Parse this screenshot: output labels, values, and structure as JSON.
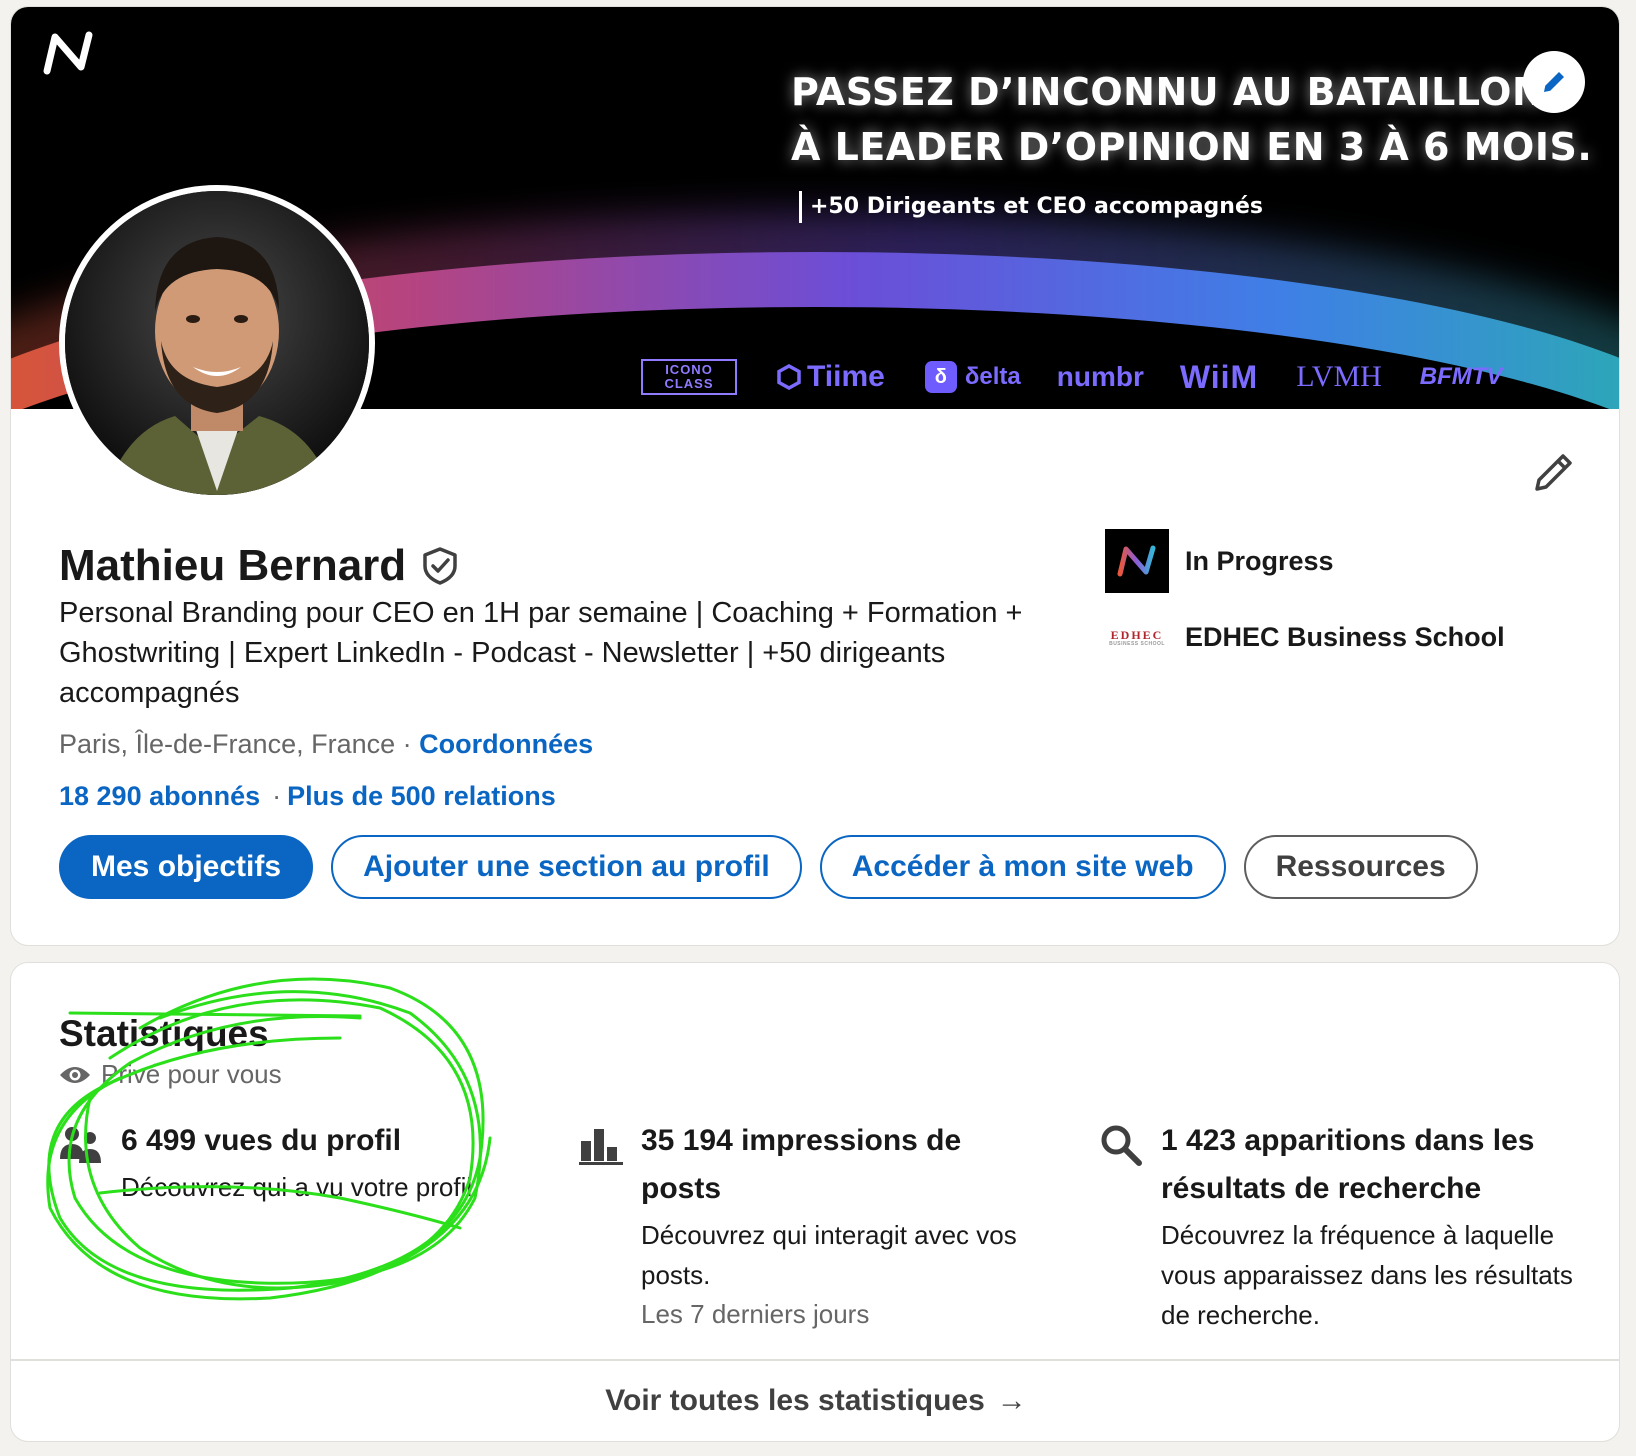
{
  "banner": {
    "headline_line1": "PASSEZ D’INCONNU AU BATAILLON",
    "headline_line2": "À LEADER D’OPINION EN 3 À 6 MOIS.",
    "subhead": "+50 Dirigeants et CEO accompagnés",
    "logos": {
      "icono_line1": "ICONO",
      "icono_line2": "CLASS",
      "tiime": "Tiime",
      "delta_mark": "δ",
      "delta": "δelta",
      "numbr": "numbr",
      "wiim": "WiiM",
      "lvmh": "LVMH",
      "bfmtv": "BFMTV"
    }
  },
  "profile": {
    "name": "Mathieu Bernard",
    "tagline": "Personal Branding pour CEO en 1H par semaine | Coaching + Formation + Ghostwriting | Expert LinkedIn - Podcast - Newsletter | +50 dirigeants accompagnés",
    "location": "Paris, Île-de-France, France",
    "location_separator": " · ",
    "contact_link": "Coordonnées",
    "followers": "18 290 abonnés",
    "connections": "Plus de 500 relations",
    "affiliations": [
      {
        "name": "In Progress",
        "logo_icon": "in-progress-logo"
      },
      {
        "name": "EDHEC Business School",
        "logo_text": "EDHEC",
        "logo_subtext": "BUSINESS SCHOOL"
      }
    ]
  },
  "actions": {
    "primary": "Mes objectifs",
    "add_section": "Ajouter une section au profil",
    "website": "Accéder à mon site web",
    "resources": "Ressources"
  },
  "stats": {
    "title": "Statistiques",
    "privacy": "Privé pour vous",
    "items": [
      {
        "icon": "people-icon",
        "value": "6 499 vues du profil",
        "desc": "Découvrez qui a vu votre profil."
      },
      {
        "icon": "bar-chart-icon",
        "value": "35 194 impressions de posts",
        "desc": "Découvrez qui interagit avec vos posts.",
        "note": "Les 7 derniers jours"
      },
      {
        "icon": "search-icon",
        "value": "1 423 apparitions dans les résultats de recherche",
        "desc": "Découvrez la fréquence à laquelle vous apparaissez dans les résultats de recherche."
      }
    ],
    "footer_link": "Voir toutes les statistiques",
    "footer_arrow": "→"
  },
  "colors": {
    "linkedin_blue": "#0a66c2",
    "highlight_green": "#2bdf1a",
    "logo_purple": "#7c6bff"
  }
}
